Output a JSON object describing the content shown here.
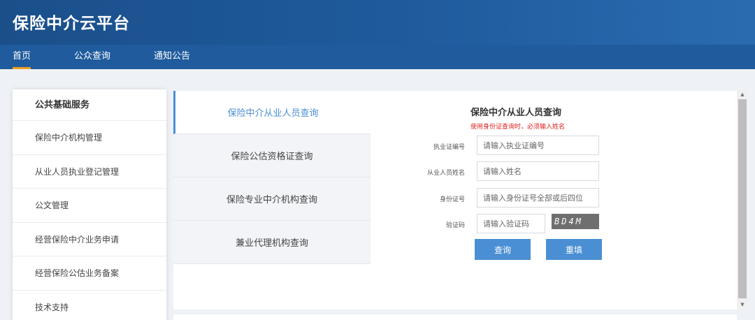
{
  "header": {
    "title": "保险中介云平台"
  },
  "nav": {
    "items": [
      "首页",
      "公众查询",
      "通知公告"
    ]
  },
  "sidebar": {
    "heading": "公共基础服务",
    "items": [
      "保险中介机构管理",
      "从业人员执业登记管理",
      "公文管理",
      "经营保险中介业务申请",
      "经营保险公估业务备案",
      "技术支持"
    ]
  },
  "tabs": [
    "保险中介从业人员查询",
    "保险公估资格证查询",
    "保险专业中介机构查询",
    "兼业代理机构查询"
  ],
  "form": {
    "title": "保险中介从业人员查询",
    "note": "使用身份证查询时，必须输入姓名",
    "fields": [
      {
        "label": "执业证编号",
        "placeholder": "请输入执业证编号"
      },
      {
        "label": "从业人员姓名",
        "placeholder": "请输入姓名"
      },
      {
        "label": "身份证号",
        "placeholder": "请输入身份证号全部或后四位"
      },
      {
        "label": "验证码",
        "placeholder": "请输入验证码"
      }
    ],
    "captcha_text": "BD4M",
    "submit_label": "查询",
    "reset_label": "重填"
  },
  "colors": {
    "header": "#1f5b9d",
    "accent": "#4a8fd4",
    "nav_underline": "#f0a020",
    "note": "#e02020"
  }
}
